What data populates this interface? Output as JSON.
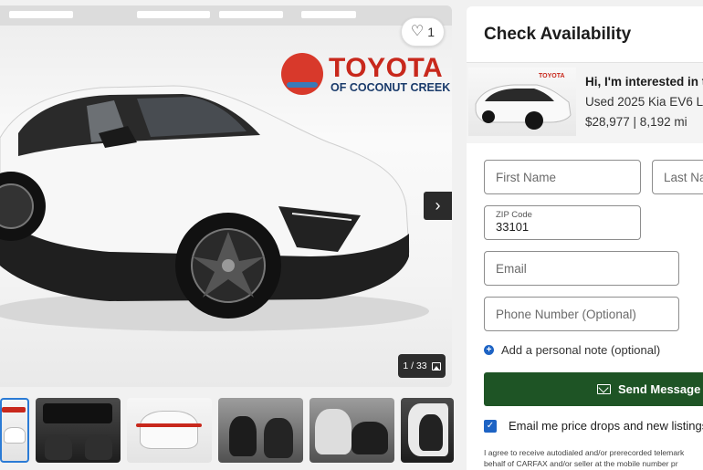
{
  "gallery": {
    "favorite_count": "1",
    "photo_counter": "1 / 33",
    "dealer_logo": {
      "brand": "TOYOTA",
      "subtitle": "OF COCONUT CREEK"
    },
    "thumbnails_count": 6
  },
  "panel": {
    "title": "Check Availability",
    "listing": {
      "message": "Hi, I'm interested in t",
      "vehicle": "Used 2025 Kia EV6 L",
      "price_mileage": "$28,977 | 8,192 mi",
      "thumb_logo": "TOYOTA"
    },
    "form": {
      "first_name_placeholder": "First Name",
      "last_name_placeholder": "Last Na",
      "zip_label": "ZIP Code",
      "zip_value": "33101",
      "email_placeholder": "Email",
      "phone_placeholder": "Phone Number (Optional)"
    },
    "add_note_label": "Add a personal note (optional)",
    "send_button_label": "Send Message",
    "email_opt_in_label": "Email me price drops and new listings",
    "legal_line1": "I agree to receive autodialed and/or prerecorded telemark",
    "legal_line2": "behalf of CARFAX and/or seller at the mobile number pr"
  },
  "colors": {
    "send_button": "#1e5425",
    "checkbox": "#1d63c4",
    "dealer_red": "#c8281c"
  }
}
